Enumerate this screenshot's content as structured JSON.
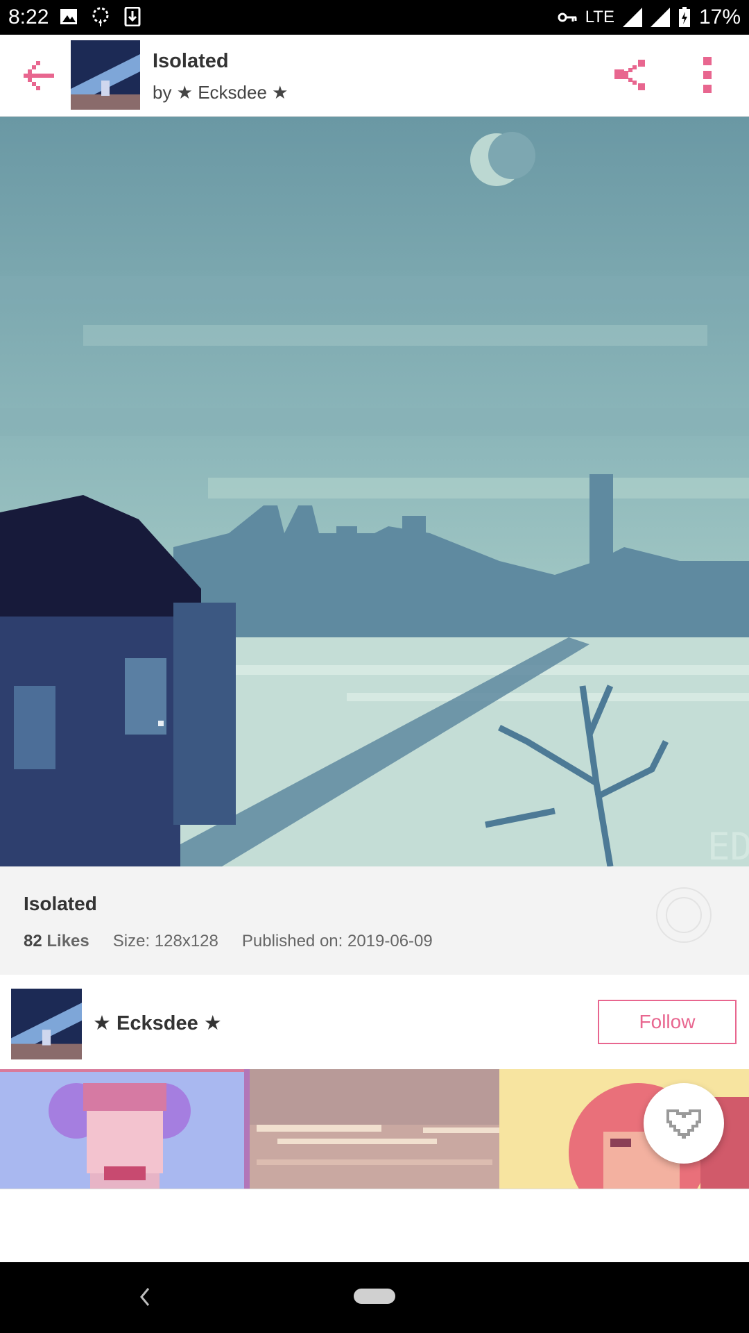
{
  "status_bar": {
    "time": "8:22",
    "network": "LTE",
    "battery": "17%",
    "icons_left": [
      "image-icon",
      "pinwheel-icon",
      "download-icon"
    ],
    "icons_right": [
      "vpn-key-icon",
      "signal-icon",
      "signal-icon",
      "battery-charging-icon"
    ]
  },
  "header": {
    "title": "Isolated",
    "byline": "by ★ Ecksdee ★",
    "accent_color": "#e8668f"
  },
  "artwork": {
    "description_icon": "pixel-art-image",
    "signature": "ED"
  },
  "info": {
    "title": "Isolated",
    "likes_count": "82",
    "likes_label": "Likes",
    "size": "Size: 128x128",
    "published": "Published on: 2019-06-09"
  },
  "author": {
    "name": "★ Ecksdee ★",
    "follow_label": "Follow"
  },
  "gallery": {
    "items": [
      "gallery-item-1",
      "gallery-item-2",
      "gallery-item-3"
    ]
  },
  "colors": {
    "accent": "#e8668f",
    "panel_bg": "#f3f3f3",
    "sky": "#6e9aa6",
    "snow": "#c9e0d9"
  }
}
